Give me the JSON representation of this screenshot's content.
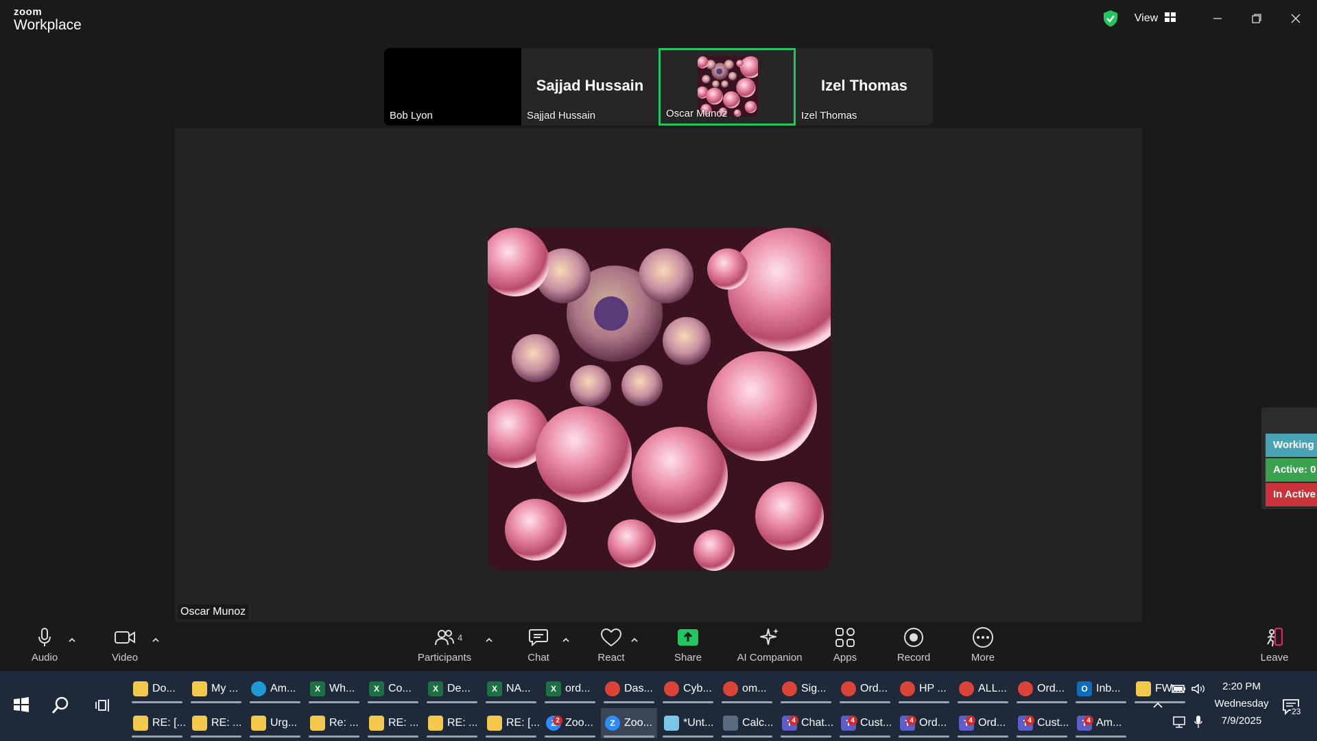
{
  "titlebar": {
    "brand_top": "zoom",
    "brand_bottom": "Workplace",
    "view_label": "View",
    "colors": {
      "shield": "#22c55e"
    }
  },
  "thumbnails": [
    {
      "name": "Bob Lyon",
      "big_label": "",
      "video": "black"
    },
    {
      "name": "Sajjad Hussain",
      "big_label": "Sajjad Hussain",
      "video": "none"
    },
    {
      "name": "Oscar Munoz",
      "big_label": "",
      "video": "avatar",
      "active": true
    },
    {
      "name": "Izel Thomas",
      "big_label": "Izel Thomas",
      "video": "none"
    }
  ],
  "main_video": {
    "name": "Oscar Munoz"
  },
  "side_widget": {
    "working": "Working",
    "active": "Active: 0",
    "inactive": "In Active",
    "colors": {
      "working": "#4aa3b4",
      "active": "#3aa14f",
      "inactive": "#c8343a"
    }
  },
  "toolbar": {
    "audio": "Audio",
    "video": "Video",
    "participants": "Participants",
    "participants_count": "4",
    "chat": "Chat",
    "react": "React",
    "share": "Share",
    "ai_companion": "AI Companion",
    "apps": "Apps",
    "record": "Record",
    "more": "More",
    "leave": "Leave",
    "colors": {
      "share": "#22c55e",
      "leave": "#e0245e"
    }
  },
  "taskbar": {
    "row1": [
      {
        "label": "Do...",
        "icon": "folder-icon",
        "color": "#f2c94c"
      },
      {
        "label": "My ...",
        "icon": "folder-icon",
        "color": "#f2c94c"
      },
      {
        "label": "Am...",
        "icon": "edge-icon",
        "color": "#1e9bd7"
      },
      {
        "label": "Wh...",
        "icon": "excel-icon",
        "color": "#1d7044"
      },
      {
        "label": "Co...",
        "icon": "excel-icon",
        "color": "#1d7044"
      },
      {
        "label": "De...",
        "icon": "excel-icon",
        "color": "#1d7044"
      },
      {
        "label": "NA...",
        "icon": "excel-icon",
        "color": "#1d7044"
      },
      {
        "label": "ord...",
        "icon": "excel-icon",
        "color": "#1d7044"
      },
      {
        "label": "Das...",
        "icon": "chrome-icon",
        "color": "#db4437"
      },
      {
        "label": "Cyb...",
        "icon": "chrome-icon",
        "color": "#db4437"
      },
      {
        "label": "om...",
        "icon": "chrome-icon",
        "color": "#db4437"
      },
      {
        "label": "Sig...",
        "icon": "chrome-icon",
        "color": "#db4437"
      },
      {
        "label": "Ord...",
        "icon": "chrome-icon",
        "color": "#db4437"
      },
      {
        "label": "HP ...",
        "icon": "chrome-icon",
        "color": "#db4437"
      },
      {
        "label": "ALL...",
        "icon": "chrome-icon",
        "color": "#db4437"
      },
      {
        "label": "Ord...",
        "icon": "chrome-icon",
        "color": "#db4437"
      },
      {
        "label": "Inb...",
        "icon": "outlook-icon",
        "color": "#0f6cbd"
      },
      {
        "label": "FW:...",
        "icon": "mail-icon",
        "color": "#f2c94c"
      }
    ],
    "row2": [
      {
        "label": "RE: [...",
        "icon": "mail-icon",
        "color": "#f2c94c"
      },
      {
        "label": "RE: ...",
        "icon": "mail-icon",
        "color": "#f2c94c"
      },
      {
        "label": "Urg...",
        "icon": "mail-icon",
        "color": "#f2c94c"
      },
      {
        "label": "Re: ...",
        "icon": "mail-icon",
        "color": "#f2c94c"
      },
      {
        "label": "RE: ...",
        "icon": "mail-icon",
        "color": "#f2c94c"
      },
      {
        "label": "RE: ...",
        "icon": "mail-icon",
        "color": "#f2c94c"
      },
      {
        "label": "RE: [...",
        "icon": "mail-icon",
        "color": "#f2c94c"
      },
      {
        "label": "Zoo...",
        "icon": "zoom-icon",
        "color": "#2d8cff",
        "badge": "2"
      },
      {
        "label": "Zoo...",
        "icon": "zoom-icon",
        "color": "#2d8cff",
        "current": true
      },
      {
        "label": "*Unt...",
        "icon": "notepad-icon",
        "color": "#7cc4e8"
      },
      {
        "label": "Calc...",
        "icon": "calculator-icon",
        "color": "#5a6b7f"
      },
      {
        "label": "Chat...",
        "icon": "teams-icon",
        "color": "#5b5fc7",
        "badge": "4"
      },
      {
        "label": "Cust...",
        "icon": "teams-icon",
        "color": "#5b5fc7",
        "badge": "4"
      },
      {
        "label": "Ord...",
        "icon": "teams-icon",
        "color": "#5b5fc7",
        "badge": "4"
      },
      {
        "label": "Ord...",
        "icon": "teams-icon",
        "color": "#5b5fc7",
        "badge": "4"
      },
      {
        "label": "Cust...",
        "icon": "teams-icon",
        "color": "#5b5fc7",
        "badge": "4"
      },
      {
        "label": "Am...",
        "icon": "teams-icon",
        "color": "#5b5fc7",
        "badge": "4"
      }
    ],
    "clock": {
      "time": "2:20 PM",
      "day": "Wednesday",
      "date": "7/9/2025"
    },
    "notifications": "23"
  }
}
